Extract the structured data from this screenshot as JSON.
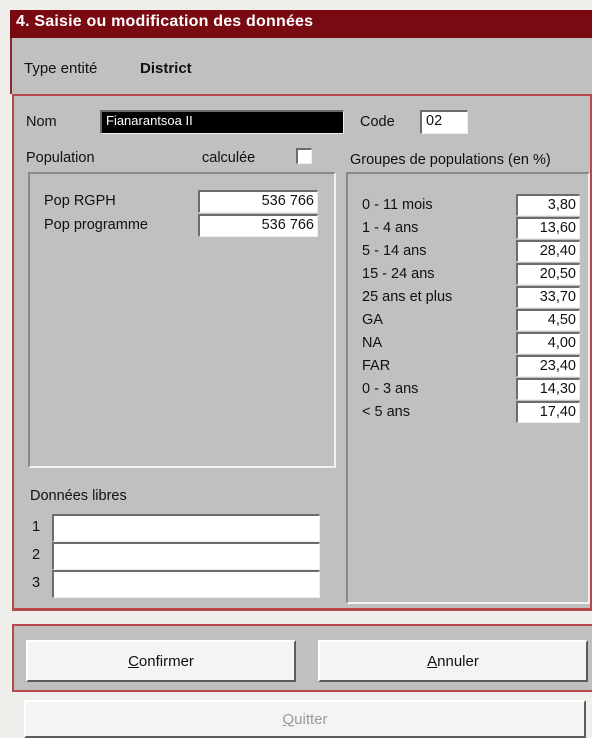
{
  "window": {
    "title": "4. Saisie ou modification des données"
  },
  "entity": {
    "type_label": "Type entité",
    "type_value": "District"
  },
  "form": {
    "nom_label": "Nom",
    "nom_value": "Fianarantsoa II",
    "code_label": "Code",
    "code_value": "02"
  },
  "population": {
    "label": "Population",
    "calculee_label": "calculée",
    "calculee_checked": false,
    "rows": [
      {
        "label": "Pop RGPH",
        "value": "536 766"
      },
      {
        "label": "Pop programme",
        "value": "536 766"
      }
    ]
  },
  "groups": {
    "label": "Groupes de populations (en %)",
    "rows": [
      {
        "label": "0 - 11 mois",
        "value": "3,80"
      },
      {
        "label": "1 - 4 ans",
        "value": "13,60"
      },
      {
        "label": "5 - 14 ans",
        "value": "28,40"
      },
      {
        "label": "15 - 24 ans",
        "value": "20,50"
      },
      {
        "label": "25 ans et plus",
        "value": "33,70"
      },
      {
        "label": "GA",
        "value": "4,50"
      },
      {
        "label": "NA",
        "value": "4,00"
      },
      {
        "label": "FAR",
        "value": "23,40"
      },
      {
        "label": "0 - 3 ans",
        "value": "14,30"
      },
      {
        "label": "< 5 ans",
        "value": "17,40"
      }
    ]
  },
  "free_data": {
    "label": "Données libres",
    "rows": [
      {
        "num": "1",
        "value": ""
      },
      {
        "num": "2",
        "value": ""
      },
      {
        "num": "3",
        "value": ""
      }
    ]
  },
  "buttons": {
    "confirm": {
      "mnemonic": "C",
      "rest": "onfirmer"
    },
    "cancel": {
      "mnemonic": "A",
      "rest": "nnuler"
    },
    "quit": {
      "mnemonic": "Q",
      "rest": "uitter"
    }
  },
  "colors": {
    "titlebar": "#7a0a12",
    "accent_border": "#b54a4a",
    "panel": "#c0c0c0"
  }
}
